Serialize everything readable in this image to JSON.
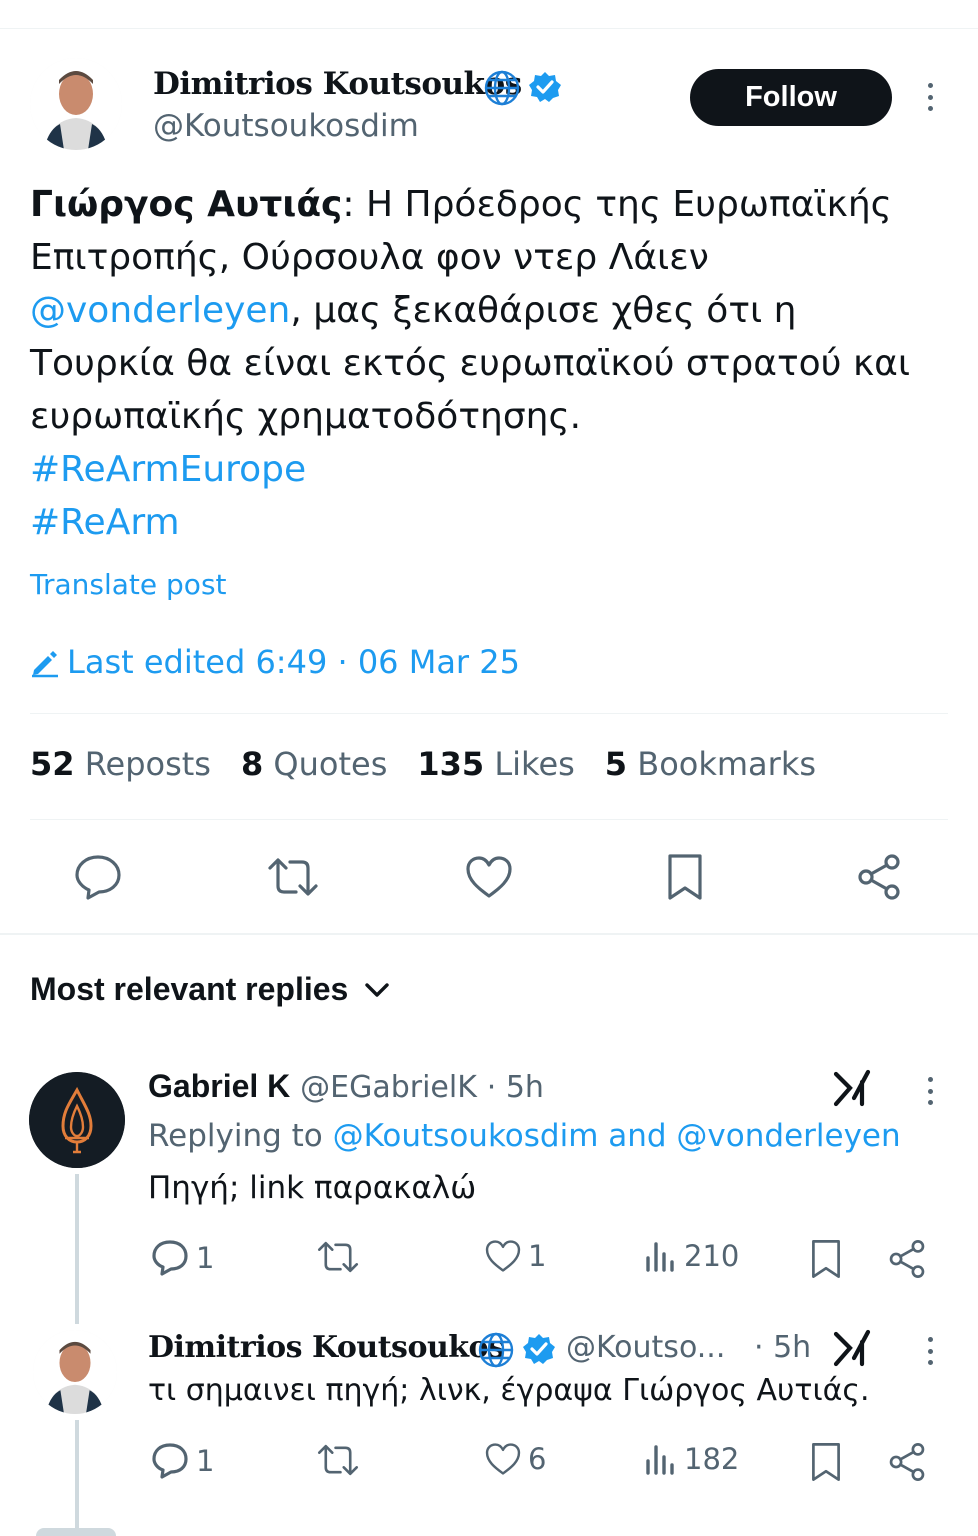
{
  "tweet": {
    "author_name": "Dimitrios Koutsoukos",
    "author_handle": "@Koutsoukosdim",
    "follow_label": "Follow",
    "lead": "Γιώργος Αυτιάς",
    "text_part1": ": Η Πρόεδρος της Ευρωπαϊκής Επιτροπής, Ούρσουλα φον ντερ Λάιεν ",
    "mention": "@vonderleyen",
    "text_part2": ", μας ξεκαθάρισε χθες ότι η Τουρκία θα είναι εκτός ευρωπαϊκού στρατού και ευρωπαϊκής χρηματοδότησης.",
    "hashtag1": "#ReArmEurope",
    "hashtag2": "#ReArm",
    "translate_label": "Translate post",
    "edited_label": "Last edited 6:49 · 06 Mar 25",
    "stats": {
      "reposts_count": "52",
      "reposts_label": "Reposts",
      "quotes_count": "8",
      "quotes_label": "Quotes",
      "likes_count": "135",
      "likes_label": "Likes",
      "bookmarks_count": "5",
      "bookmarks_label": "Bookmarks"
    }
  },
  "replies_header": "Most relevant replies",
  "replies": [
    {
      "name": "Gabriel K",
      "handle": "@EGabrielK",
      "time": "· 5h",
      "replying_prefix": "Replying to ",
      "replying_targets": "@Koutsoukosdim and @vonderleyen",
      "text": "Πηγή; link παρακαλώ",
      "replies": "1",
      "reposts": "",
      "likes": "1",
      "views": "210"
    },
    {
      "name": "Dimitrios Koutsoukos",
      "handle": "@Koutso...",
      "time": "· 5h",
      "text": "τι σημαινει πηγή; λινκ, έγραψα Γιώργος Αυτιάς.",
      "replies": "1",
      "reposts": "",
      "likes": "6",
      "views": "182"
    }
  ],
  "colors": {
    "accent": "#1d9bf0",
    "text": "#0f1419",
    "muted": "#536471",
    "divider": "#eff3f4"
  },
  "icons": [
    "globe-icon",
    "verified-badge-icon",
    "more-options-icon",
    "pencil-icon",
    "reply-icon",
    "repost-icon",
    "like-icon",
    "bookmark-icon",
    "share-icon",
    "chevron-down-icon",
    "grok-icon",
    "views-icon"
  ]
}
